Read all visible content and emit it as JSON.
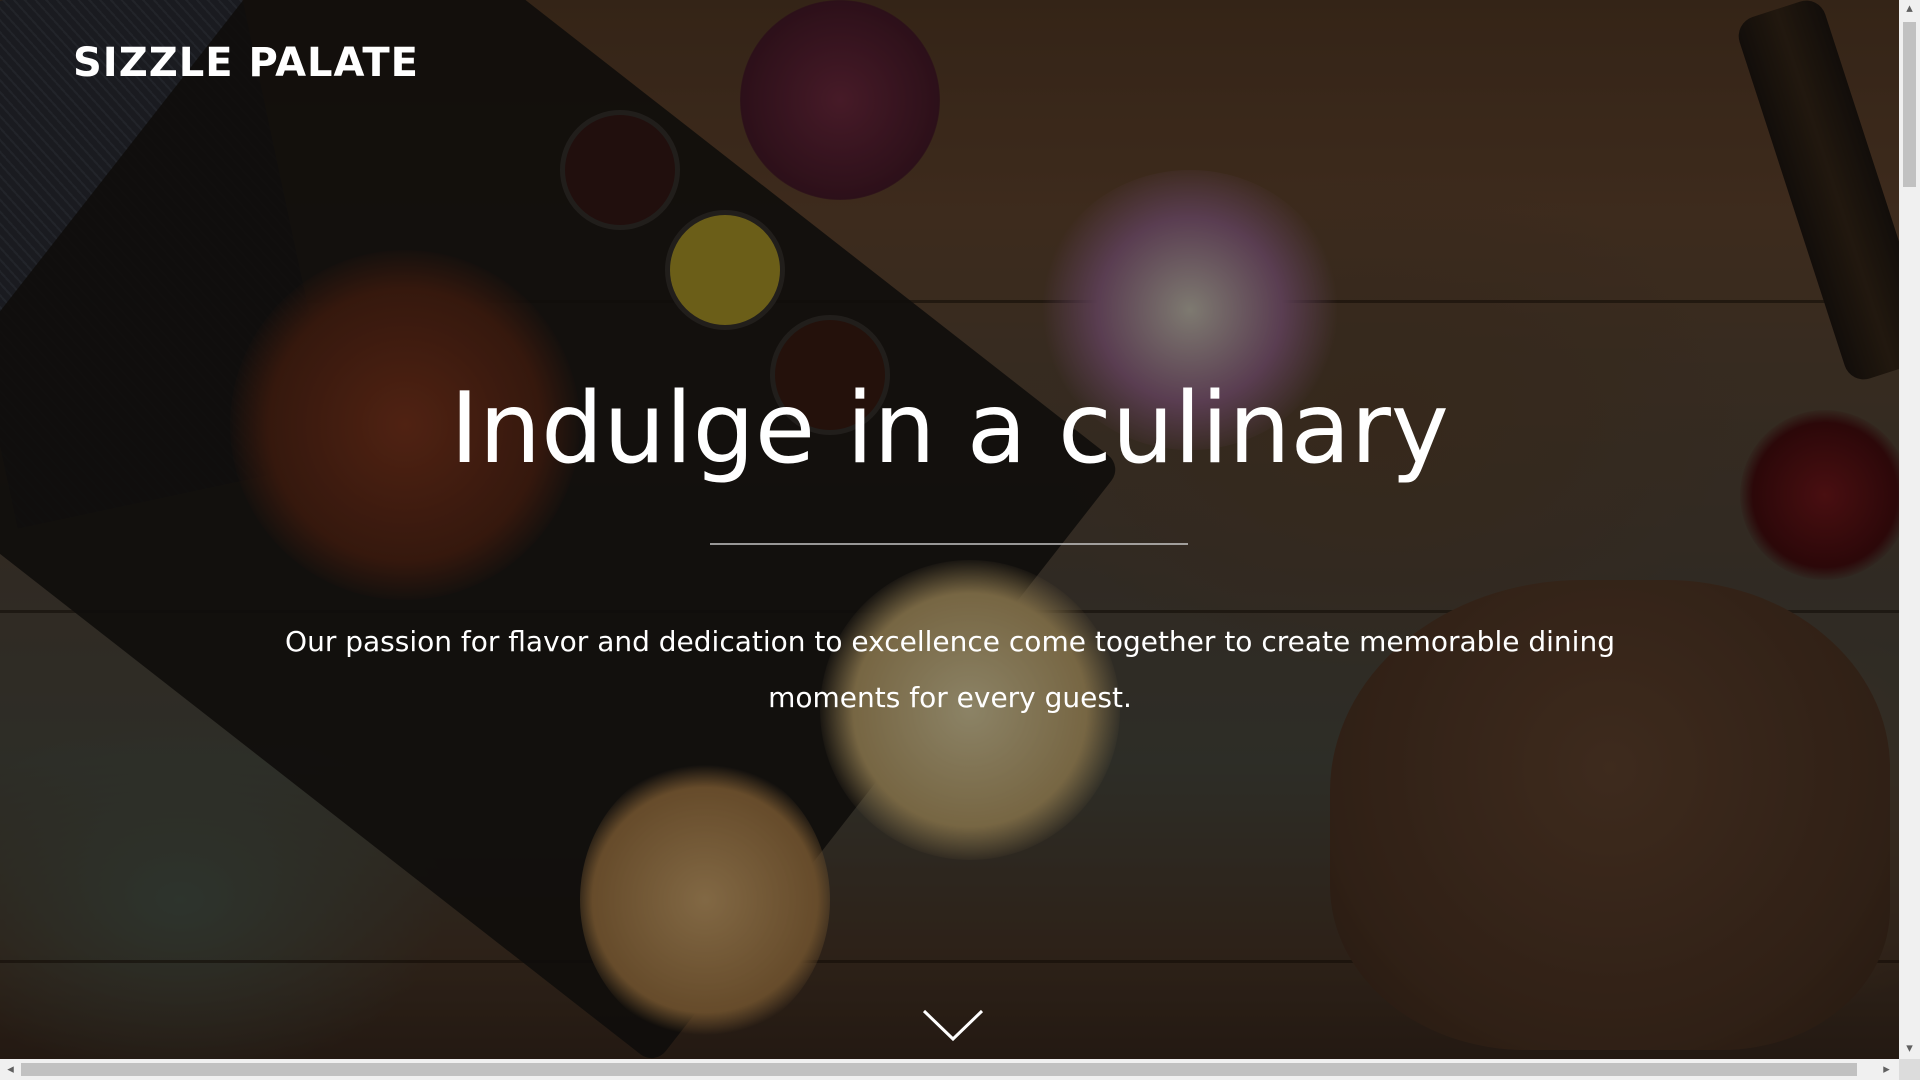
{
  "header": {
    "logo_text": "SIZZLE PALATE"
  },
  "hero": {
    "title": "Indulge in a culinary",
    "subtitle": "Our passion for flavor and dedication to excellence come together to create memorable dining moments for every guest.",
    "background_image": "restaurant-food-table-photo",
    "scroll_icon": "chevron-down-icon"
  },
  "scrollbars": {
    "vertical": {
      "up_arrow": "▴",
      "down_arrow": "▾"
    },
    "horizontal": {
      "left_arrow": "◂",
      "right_arrow": "▸"
    }
  },
  "colors": {
    "text": "#ffffff",
    "overlay": "rgba(0,0,0,0.42)",
    "divider": "#d2d2d2"
  }
}
